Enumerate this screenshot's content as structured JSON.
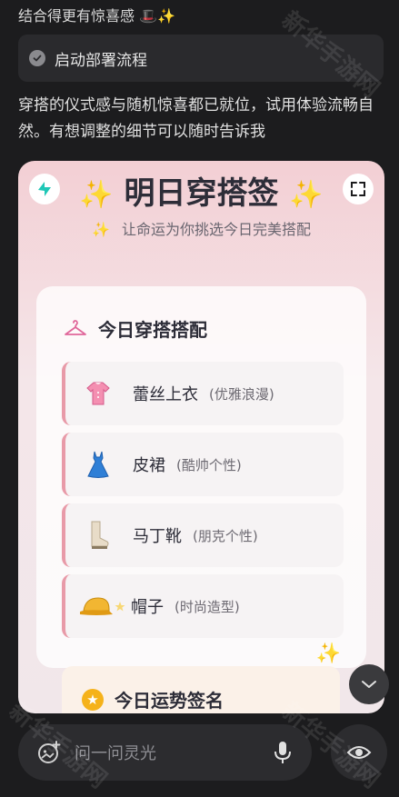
{
  "top": {
    "intro_text": "结合得更有惊喜感",
    "intro_emojis": "🎩✨"
  },
  "deploy_chip": {
    "label": "启动部署流程"
  },
  "message": {
    "text": "穿搭的仪式感与随机惊喜都已就位，试用体验流畅自然。有想调整的细节可以随时告诉我"
  },
  "card": {
    "title": "明日穿搭签",
    "title_sparkle": "✨",
    "subtitle_sparkle": "✨",
    "subtitle": "让命运为你挑选今日完美搭配",
    "outfit_heading": "今日穿搭搭配",
    "items": [
      {
        "name": "蕾丝上衣",
        "note": "(优雅浪漫)",
        "icon": "blouse-icon"
      },
      {
        "name": "皮裙",
        "note": "(酷帅个性)",
        "icon": "dress-icon"
      },
      {
        "name": "马丁靴",
        "note": "(朋克个性)",
        "icon": "boot-icon"
      },
      {
        "name": "帽子",
        "note": "(时尚造型)",
        "icon": "cap-icon"
      }
    ],
    "deco_sparkle": "✨",
    "fortune_heading": "今日运势签名",
    "fortune_star": "★"
  },
  "input": {
    "placeholder": "问一问灵光"
  },
  "watermark": "新华手游网",
  "colors": {
    "background": "#1c1c1e",
    "accent_pink": "#e89aa8",
    "sparkle_gold": "#f2c94c"
  }
}
